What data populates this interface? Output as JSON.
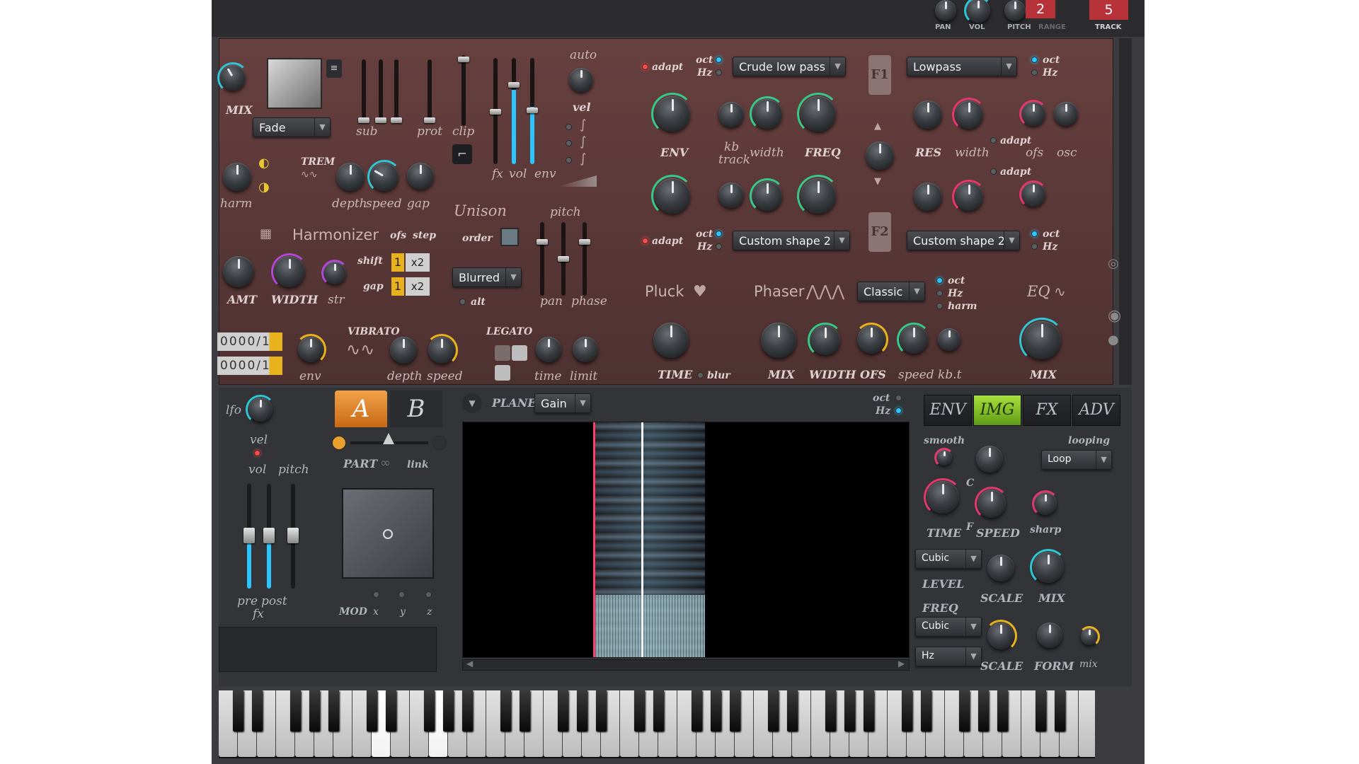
{
  "header": {
    "pan_label": "PAN",
    "vol_label": "VOL",
    "pitch_label": "PITCH",
    "range_label": "RANGE",
    "pitch_value": "2",
    "track_label": "TRACK",
    "track_value": "5"
  },
  "top_left": {
    "mix_label": "MIX",
    "fade_option": "Fade",
    "sub_label": "sub",
    "prot_label": "prot",
    "clip_label": "clip",
    "fx_label": "fx",
    "vol_label": "vol",
    "env_label": "env",
    "auto_label": "auto",
    "vel_label": "vel"
  },
  "trem": {
    "title": "TREM",
    "harm_label": "harm",
    "depth_label": "depth",
    "speed_label": "speed",
    "gap_label": "gap"
  },
  "harmonizer": {
    "title": "Harmonizer",
    "ofs_label": "ofs",
    "step_label": "step",
    "shift_label": "shift",
    "gap_label": "gap",
    "shift_value": "1",
    "shift_mult": "x2",
    "gap_value": "1",
    "gap_mult": "x2",
    "amt_label": "AMT",
    "width_label": "WIDTH",
    "str_label": "str"
  },
  "unison": {
    "title": "Unison",
    "order_label": "order",
    "pitch_label": "pitch",
    "blur_option": "Blurred",
    "alt_label": "alt",
    "pan_label": "pan",
    "phase_label": "phase"
  },
  "vibrato": {
    "title": "VIBRATO",
    "env_label": "env",
    "depth_label": "depth",
    "speed_label": "speed",
    "counter1": "0000/1",
    "counter2": "0000/1"
  },
  "legato": {
    "title": "LEGATO",
    "time_label": "time",
    "limit_label": "limit"
  },
  "filter1": {
    "adapt_label": "adapt",
    "oct_label": "oct",
    "hz_label": "Hz",
    "type": "Crude low pass",
    "badge": "F1",
    "env_label": "ENV",
    "kb_label": "kb",
    "track_label": "track",
    "width_label": "width",
    "freq_label": "FREQ"
  },
  "filter1b": {
    "type": "Lowpass",
    "oct_label": "oct",
    "hz_label": "Hz",
    "res_label": "RES",
    "width_label": "width",
    "adapt_label": "adapt",
    "ofs_label": "ofs",
    "osc_label": "osc"
  },
  "filter2": {
    "adapt_label": "adapt",
    "oct_label": "oct",
    "hz_label": "Hz",
    "type": "Custom shape 2",
    "badge": "F2"
  },
  "filter2b": {
    "type": "Custom shape 2",
    "oct_label": "oct",
    "hz_label": "Hz",
    "adapt_label": "adapt"
  },
  "pluck": {
    "title": "Pluck",
    "time_label": "TIME",
    "blur_label": "blur"
  },
  "phaser": {
    "title": "Phaser",
    "mode": "Classic",
    "oct_label": "oct",
    "hz_label": "Hz",
    "harm_label": "harm",
    "mix_label": "MIX",
    "width_label": "WIDTH",
    "ofs_label": "OFS",
    "speed_label": "speed",
    "kbt_label": "kb.t"
  },
  "eq": {
    "title": "EQ",
    "mix_label": "MIX"
  },
  "lower_left": {
    "lfo_label": "lfo",
    "vel_label": "vel",
    "vol_label": "vol",
    "pitch_label": "pitch",
    "pre_label": "pre",
    "post_label": "post",
    "fx_label": "fx",
    "part_label": "PART",
    "link_label": "link",
    "mod_label": "MOD",
    "x_label": "x",
    "y_label": "y",
    "z_label": "z",
    "tab_a": "A",
    "tab_b": "B"
  },
  "plane": {
    "label": "PLANE",
    "mode": "Gain",
    "oct_label": "oct",
    "hz_label": "Hz"
  },
  "tabs": [
    {
      "label": "ENV",
      "active": false
    },
    {
      "label": "IMG",
      "active": true
    },
    {
      "label": "FX",
      "active": false
    },
    {
      "label": "ADV",
      "active": false
    }
  ],
  "img_panel": {
    "smooth_label": "smooth",
    "looping_label": "looping",
    "loop_option": "Loop",
    "c_label": "C",
    "f_label": "F",
    "time_label": "TIME",
    "speed_label": "SPEED",
    "sharp_label": "sharp",
    "level_interp": "Cubic",
    "level_label": "LEVEL",
    "freq_label": "FREQ",
    "freq_interp": "Cubic",
    "hz_option": "Hz",
    "scale_label": "SCALE",
    "mix_label": "MIX",
    "form_label": "FORM",
    "mix2_label": "mix"
  },
  "colors": {
    "panel": "#5c3a3b",
    "accent_green": "#35c98b",
    "accent_teal": "#2ec6d6",
    "accent_pink": "#e3386c",
    "tab_active": "#8fd12a"
  }
}
